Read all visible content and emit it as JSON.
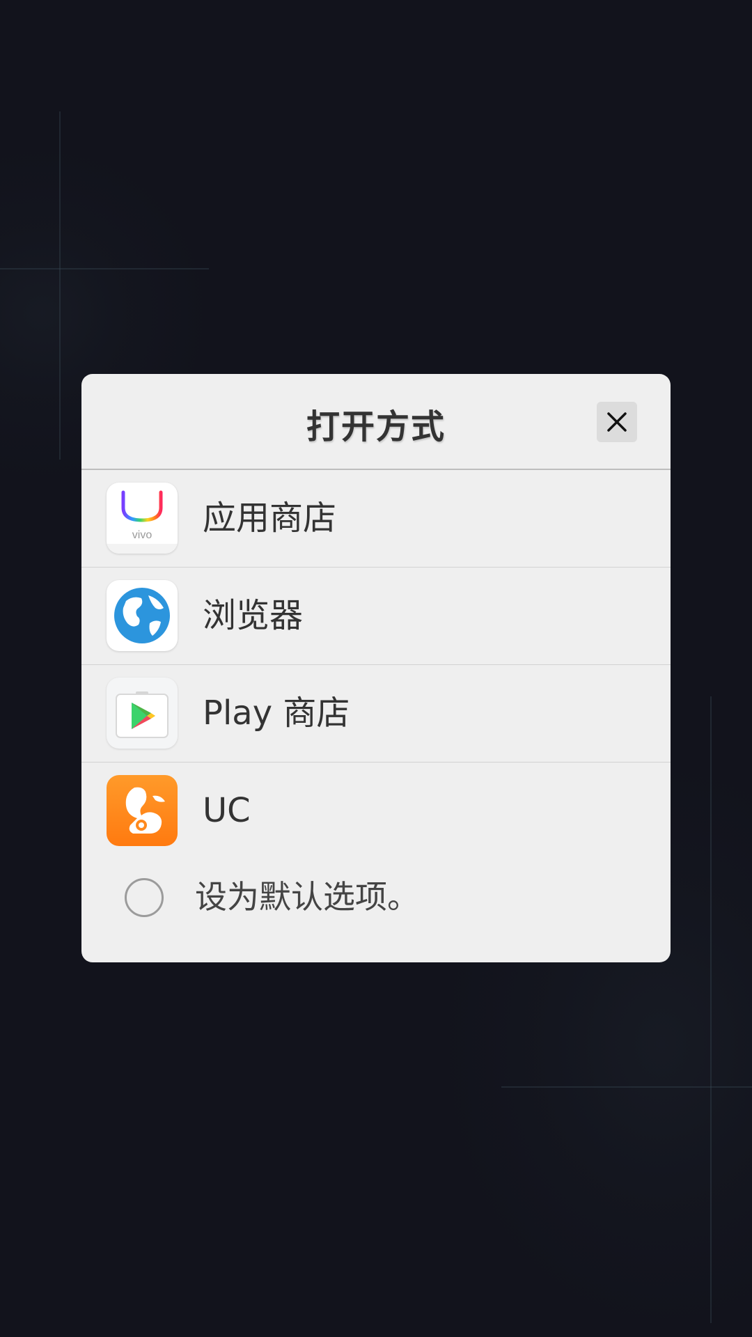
{
  "dialog": {
    "title": "打开方式",
    "close_icon": "close-icon"
  },
  "apps": [
    {
      "label": "应用商店",
      "icon": "vivo-app-store-icon",
      "icon_text": "vivo"
    },
    {
      "label": "浏览器",
      "icon": "globe-browser-icon"
    },
    {
      "label": "Play 商店",
      "icon": "google-play-icon"
    },
    {
      "label": "UC",
      "icon": "uc-browser-squirrel-icon"
    }
  ],
  "default_option": {
    "label": "设为默认选项。",
    "checked": false
  },
  "colors": {
    "background": "#12131c",
    "dialog": "#efefef",
    "text": "#333333",
    "uc_orange": "#ff8a1f"
  }
}
